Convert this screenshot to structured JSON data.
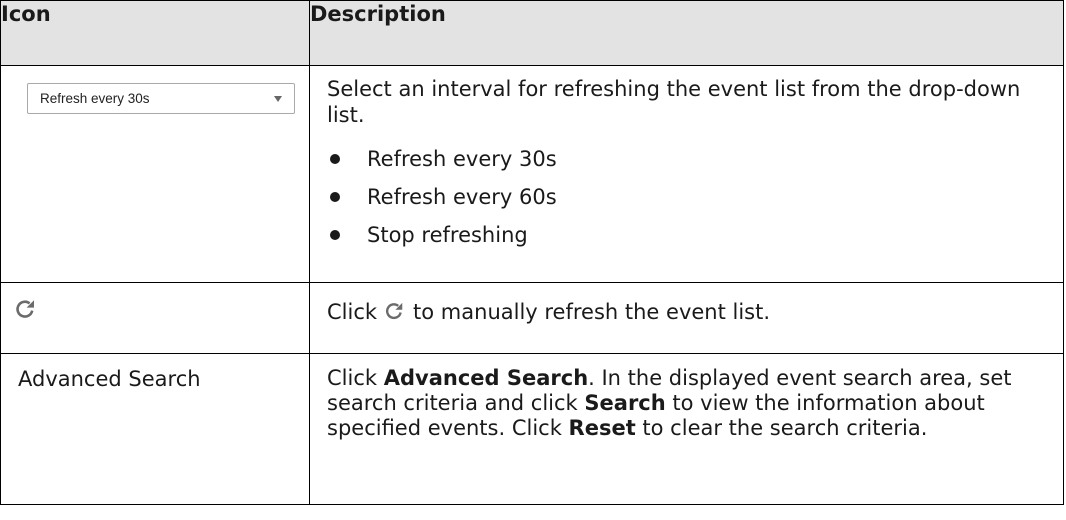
{
  "table": {
    "headers": {
      "icon": "Icon",
      "description": "Description"
    },
    "row1": {
      "dropdown_value": "Refresh every 30s",
      "description": "Select an interval for refreshing the event list from the drop-down list.",
      "options": [
        "Refresh every 30s",
        "Refresh every 60s",
        "Stop refreshing"
      ]
    },
    "row2": {
      "icon": "refresh-icon",
      "desc_prefix": "Click",
      "desc_suffix": "to manually refresh the event list."
    },
    "row3": {
      "icon_label": "Advanced Search",
      "desc_part1": "Click ",
      "desc_bold1": "Advanced Search",
      "desc_part2": ". In the displayed event search area, set search criteria and click ",
      "desc_bold2": "Search",
      "desc_part3": " to view the information about specified events. Click ",
      "desc_bold3": "Reset",
      "desc_part4": " to clear the search criteria."
    }
  },
  "colors": {
    "header_background": "#e3e3e3",
    "border": "#000000",
    "icon_gray": "#6b6b6b"
  }
}
